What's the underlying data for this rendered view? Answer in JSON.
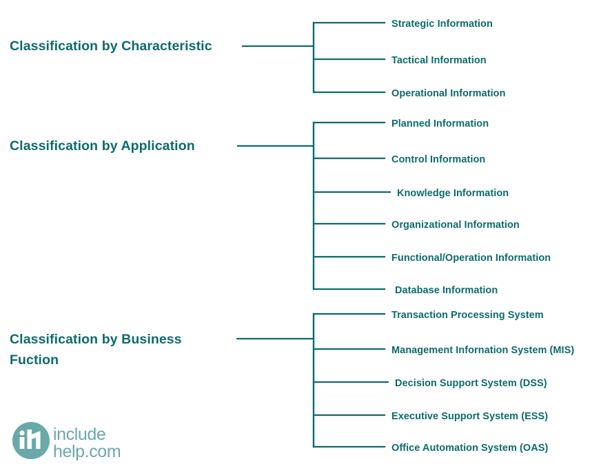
{
  "colors": {
    "line": "#0d6b6b",
    "text": "#0d6b6b",
    "logo": "#6aa9a9",
    "background": "#ffffff"
  },
  "groups": [
    {
      "heading": "Classification by Characteristic",
      "items": [
        "Strategic Information",
        "Tactical Information",
        "Operational Information"
      ]
    },
    {
      "heading_line1": "Classification by Application",
      "heading": "Classification by Application",
      "items": [
        "Planned Information",
        "Control Information",
        "Knowledge Information",
        "Organizational Information",
        "Functional/Operation Information",
        "Database Information"
      ]
    },
    {
      "heading": "Classification by Business Fuction",
      "heading_line1": "Classification by Business",
      "heading_line2": "Fuction",
      "items": [
        "Transaction Processing System",
        "Management Infornation System (MIS)",
        "Decision Support System (DSS)",
        "Executive Support System (ESS)",
        "Office Automation System (OAS)"
      ]
    }
  ],
  "logo": {
    "monogram": "ih",
    "line1": "include",
    "line2": "help.com"
  }
}
